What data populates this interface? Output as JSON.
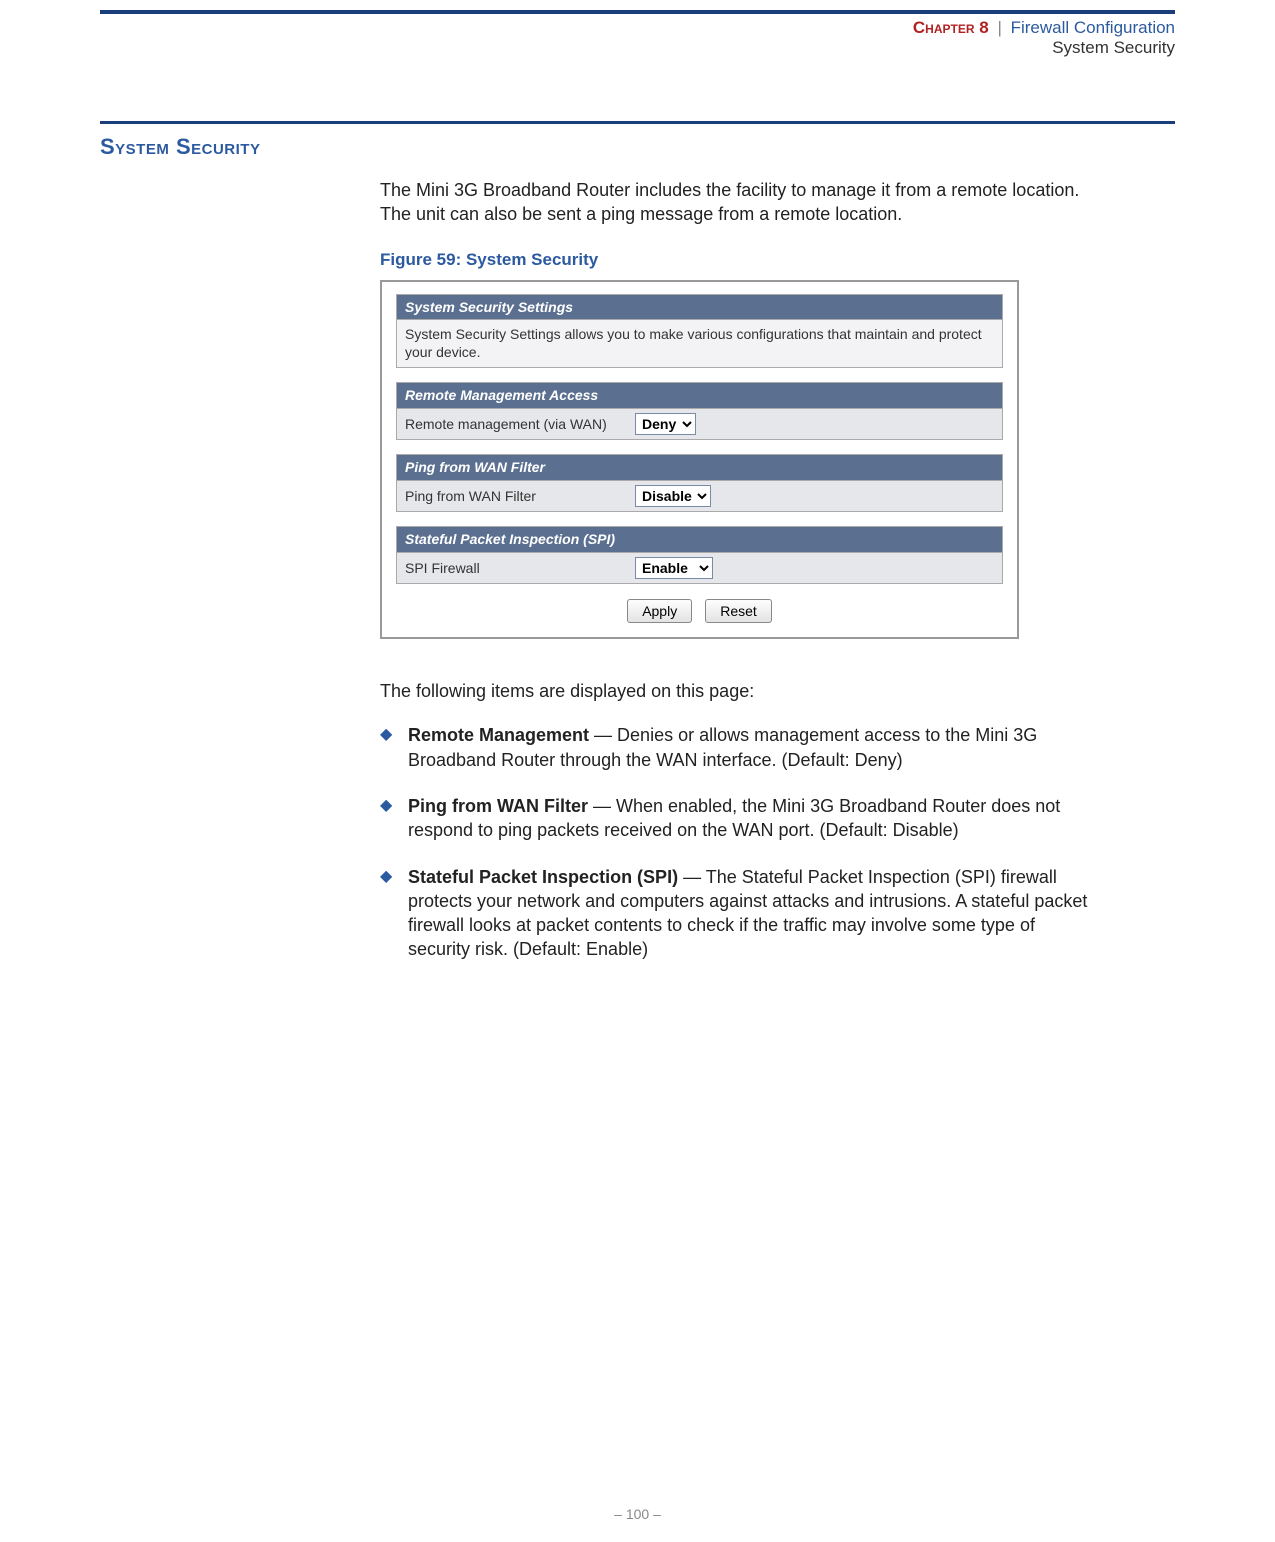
{
  "header": {
    "chapter": "Chapter 8",
    "separator": "|",
    "crumb1": "Firewall Configuration",
    "crumb2": "System Security"
  },
  "section_title": "System Security",
  "intro": "The Mini 3G Broadband Router includes the facility to manage it from a remote location. The unit can also be sent a ping message from a remote location.",
  "figure_caption": "Figure 59:  System Security",
  "screenshot": {
    "panel1": {
      "header": "System Security Settings",
      "desc": "System Security Settings allows you to make various configurations that maintain and protect your device."
    },
    "panel2": {
      "header": "Remote Management Access",
      "label": "Remote management (via WAN)",
      "value": "Deny"
    },
    "panel3": {
      "header": "Ping from WAN Filter",
      "label": "Ping from WAN Filter",
      "value": "Disable"
    },
    "panel4": {
      "header": "Stateful Packet Inspection (SPI)",
      "label": "SPI Firewall",
      "value": "Enable"
    },
    "buttons": {
      "apply": "Apply",
      "reset": "Reset"
    }
  },
  "follow_text": "The following items are displayed on this page:",
  "bullets": [
    {
      "term": "Remote Management",
      "desc": " — Denies or allows management access to the Mini 3G Broadband Router through the WAN interface. (Default: Deny)"
    },
    {
      "term": "Ping from WAN Filter",
      "desc": " — When enabled, the Mini 3G Broadband Router does not respond to ping packets received on the WAN port. (Default: Disable)"
    },
    {
      "term": "Stateful Packet Inspection (SPI)",
      "desc": " — The Stateful Packet Inspection (SPI) firewall protects your network and computers against attacks and intrusions. A stateful packet firewall looks at packet contents to check if the traffic may involve some type of security risk. (Default: Enable)"
    }
  ],
  "footer": "–  100  –"
}
